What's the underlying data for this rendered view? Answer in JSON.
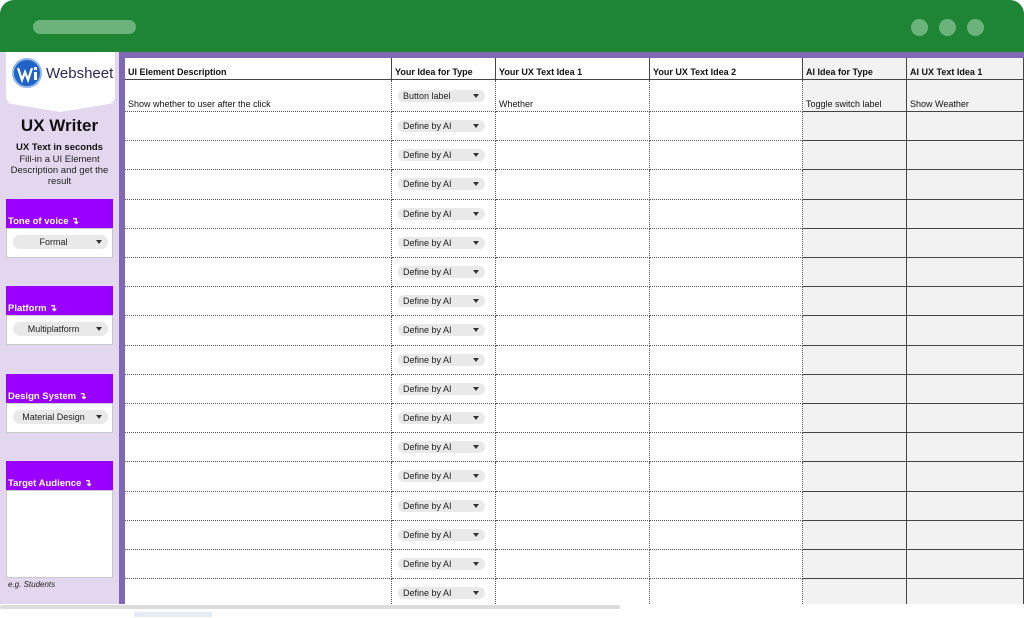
{
  "sidebar": {
    "logo_text": "Websheet",
    "title": "UX Writer",
    "tagline": "UX Text in seconds",
    "description": "Fill-in a UI Element Description and get the result",
    "sections": [
      {
        "label": "Tone of voice ↴",
        "value": "Formal"
      },
      {
        "label": "Platform ↴",
        "value": "Multiplatform"
      },
      {
        "label": "Design System ↴",
        "value": "Material Design"
      },
      {
        "label": "Target Audience ↴",
        "value": ""
      }
    ],
    "audience_example": "e.g. Students"
  },
  "grid": {
    "headers": [
      "UI Element Description",
      "Your Idea for Type",
      "Your UX Text Idea 1",
      "Your UX Text Idea 2",
      "AI Idea for Type",
      "AI UX Text Idea 1"
    ],
    "rows": [
      {
        "description": "Show whether to user after the click",
        "type": "Button label",
        "idea1": "Whether",
        "idea2": "",
        "ai_type": "Toggle switch label",
        "ai_idea1": "Show Weather"
      },
      {
        "description": "",
        "type": "Define by AI",
        "idea1": "",
        "idea2": "",
        "ai_type": "",
        "ai_idea1": ""
      },
      {
        "description": "",
        "type": "Define by AI",
        "idea1": "",
        "idea2": "",
        "ai_type": "",
        "ai_idea1": ""
      },
      {
        "description": "",
        "type": "Define by AI",
        "idea1": "",
        "idea2": "",
        "ai_type": "",
        "ai_idea1": ""
      },
      {
        "description": "",
        "type": "Define by AI",
        "idea1": "",
        "idea2": "",
        "ai_type": "",
        "ai_idea1": ""
      },
      {
        "description": "",
        "type": "Define by AI",
        "idea1": "",
        "idea2": "",
        "ai_type": "",
        "ai_idea1": ""
      },
      {
        "description": "",
        "type": "Define by AI",
        "idea1": "",
        "idea2": "",
        "ai_type": "",
        "ai_idea1": ""
      },
      {
        "description": "",
        "type": "Define by AI",
        "idea1": "",
        "idea2": "",
        "ai_type": "",
        "ai_idea1": ""
      },
      {
        "description": "",
        "type": "Define by AI",
        "idea1": "",
        "idea2": "",
        "ai_type": "",
        "ai_idea1": ""
      },
      {
        "description": "",
        "type": "Define by AI",
        "idea1": "",
        "idea2": "",
        "ai_type": "",
        "ai_idea1": ""
      },
      {
        "description": "",
        "type": "Define by AI",
        "idea1": "",
        "idea2": "",
        "ai_type": "",
        "ai_idea1": ""
      },
      {
        "description": "",
        "type": "Define by AI",
        "idea1": "",
        "idea2": "",
        "ai_type": "",
        "ai_idea1": ""
      },
      {
        "description": "",
        "type": "Define by AI",
        "idea1": "",
        "idea2": "",
        "ai_type": "",
        "ai_idea1": ""
      },
      {
        "description": "",
        "type": "Define by AI",
        "idea1": "",
        "idea2": "",
        "ai_type": "",
        "ai_idea1": ""
      },
      {
        "description": "",
        "type": "Define by AI",
        "idea1": "",
        "idea2": "",
        "ai_type": "",
        "ai_idea1": ""
      },
      {
        "description": "",
        "type": "Define by AI",
        "idea1": "",
        "idea2": "",
        "ai_type": "",
        "ai_idea1": ""
      },
      {
        "description": "",
        "type": "Define by AI",
        "idea1": "",
        "idea2": "",
        "ai_type": "",
        "ai_idea1": ""
      },
      {
        "description": "",
        "type": "Define by AI",
        "idea1": "",
        "idea2": "",
        "ai_type": "",
        "ai_idea1": ""
      }
    ]
  },
  "colors": {
    "chrome": "#1e8535",
    "accent": "#9900ff",
    "sidebar_bg": "#e2d7ee",
    "sidebar_edge": "#7f69b4"
  }
}
